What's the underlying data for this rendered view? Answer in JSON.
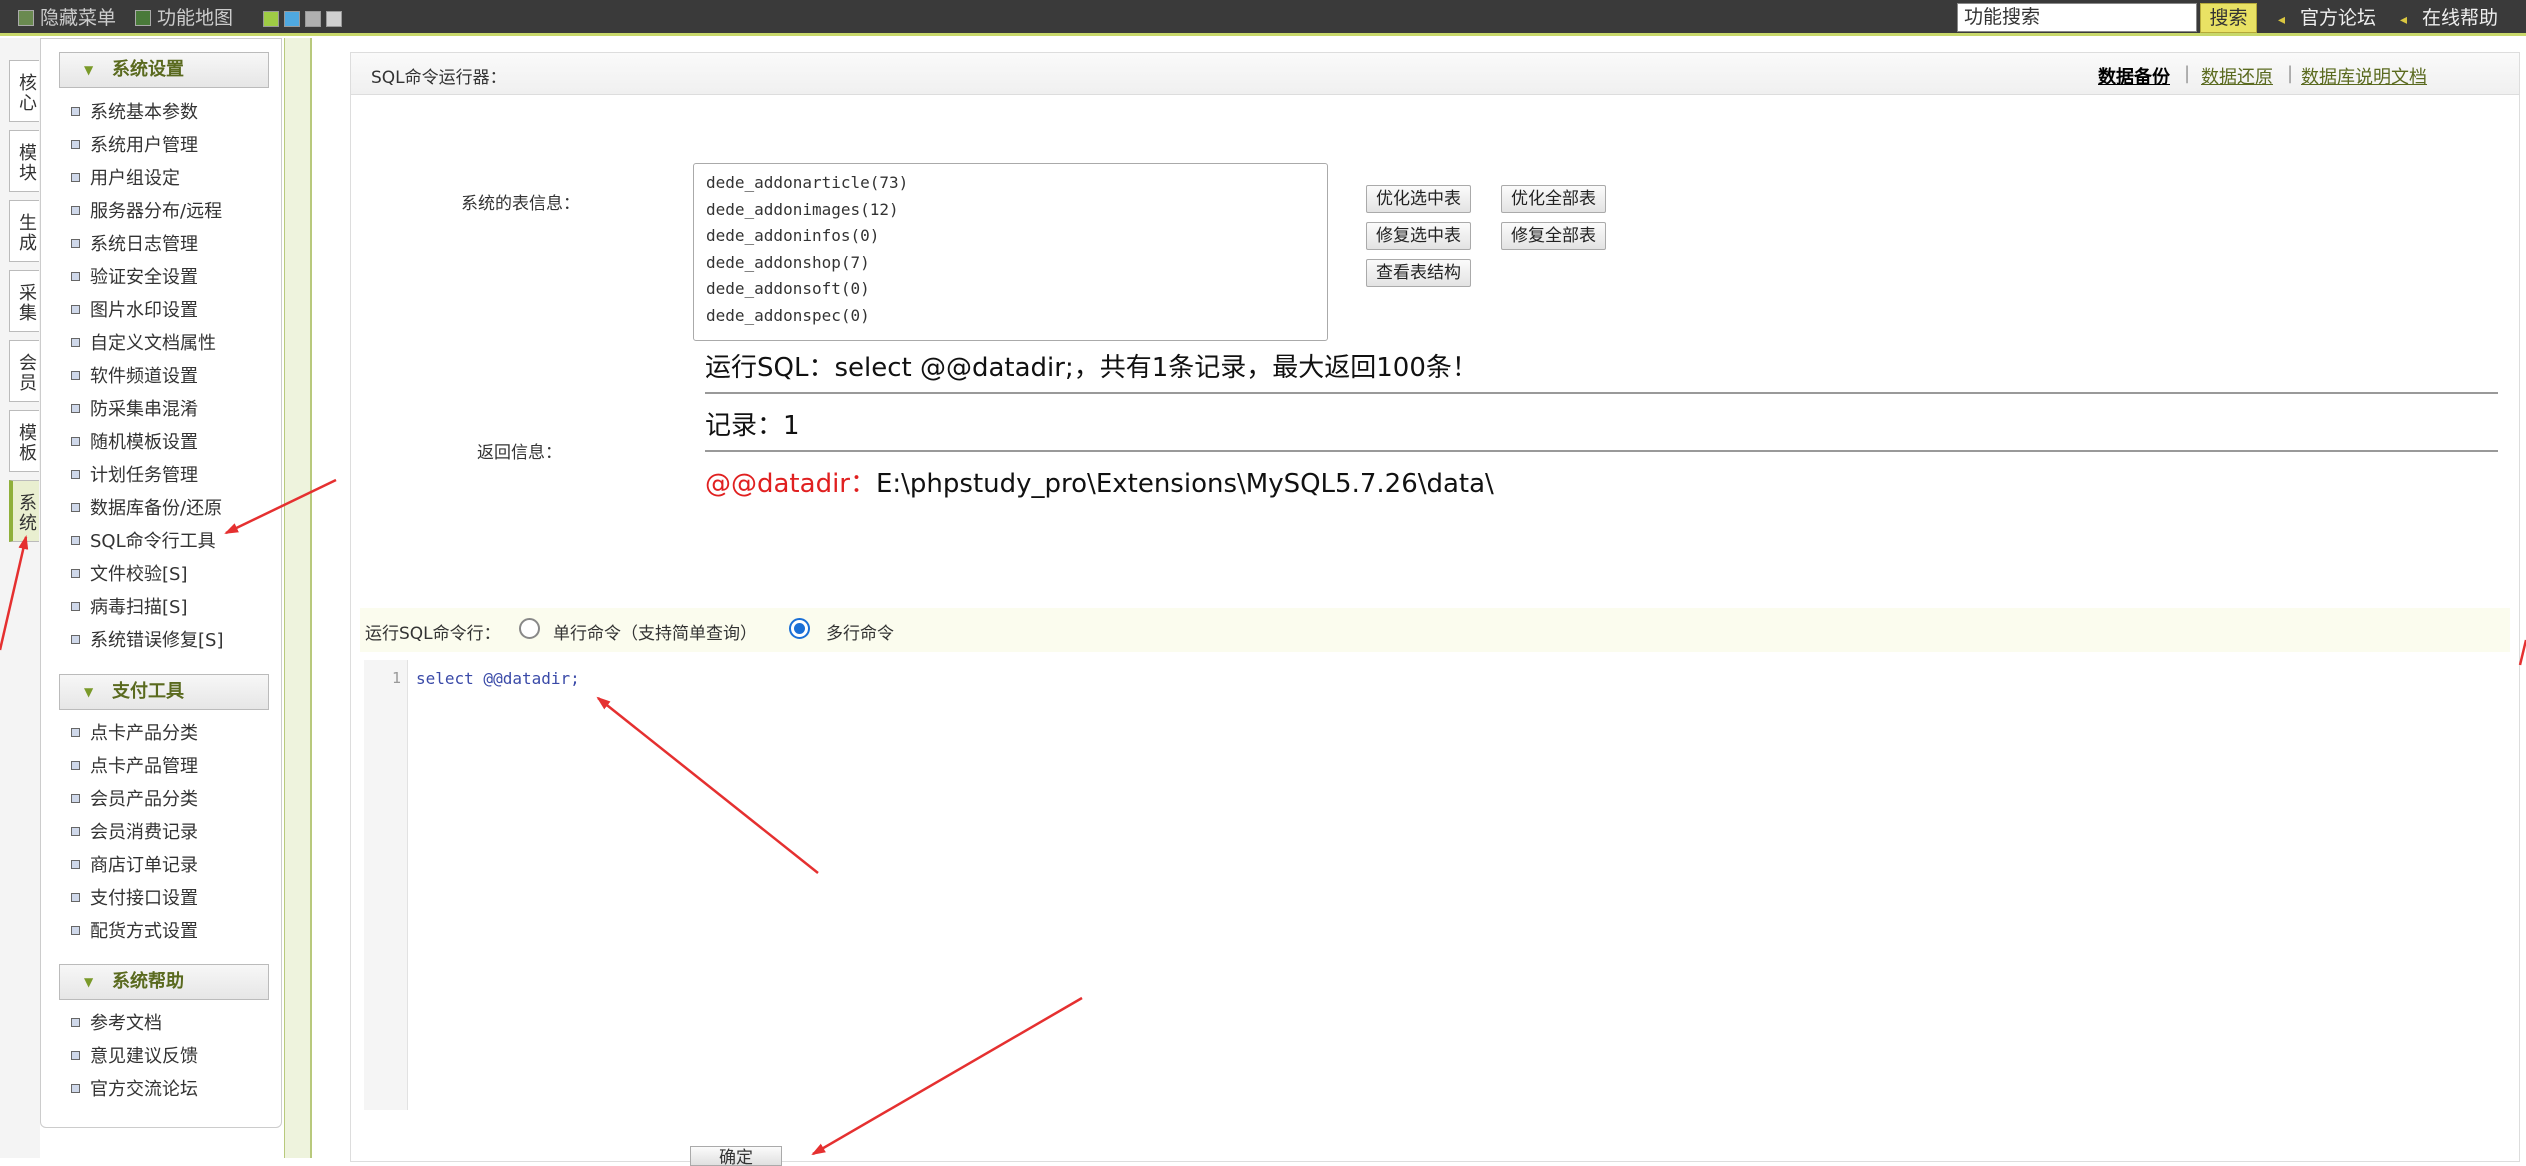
{
  "topbar": {
    "hide_menu": "隐藏菜单",
    "func_map": "功能地图",
    "swatch_colors": [
      "#9ecb45",
      "#4fa8e0",
      "#b0b0b0",
      "#d0d0d0"
    ],
    "search_placeholder": "功能搜索",
    "search_btn": "搜索",
    "forum": "官方论坛",
    "help": "在线帮助"
  },
  "vtabs": [
    "核心",
    "模块",
    "生成",
    "采集",
    "会员",
    "模板",
    "系统"
  ],
  "vtab_active": "系统",
  "sidebar": {
    "sections": [
      {
        "title": "系统设置",
        "items": [
          "系统基本参数",
          "系统用户管理",
          "用户组设定",
          "服务器分布/远程",
          "系统日志管理",
          "验证安全设置",
          "图片水印设置",
          "自定义文档属性",
          "软件频道设置",
          "防采集串混淆",
          "随机模板设置",
          "计划任务管理",
          "数据库备份/还原",
          "SQL命令行工具",
          "文件校验[S]",
          "病毒扫描[S]",
          "系统错误修复[S]"
        ]
      },
      {
        "title": "支付工具",
        "items": [
          "点卡产品分类",
          "点卡产品管理",
          "会员产品分类",
          "会员消费记录",
          "商店订单记录",
          "支付接口设置",
          "配货方式设置"
        ]
      },
      {
        "title": "系统帮助",
        "items": [
          "参考文档",
          "意见建议反馈",
          "官方交流论坛"
        ]
      }
    ]
  },
  "main": {
    "title": "SQL命令运行器：",
    "links": [
      "数据备份",
      "数据还原",
      "数据库说明文档"
    ],
    "table_info_label": "系统的表信息：",
    "tables": [
      "dede_addonarticle(73)",
      "dede_addonimages(12)",
      "dede_addoninfos(0)",
      "dede_addonshop(7)",
      "dede_addonsoft(0)",
      "dede_addonspec(0)"
    ],
    "buttons": {
      "optimize_selected": "优化选中表",
      "optimize_all": "优化全部表",
      "repair_selected": "修复选中表",
      "repair_all": "修复全部表",
      "view_structure": "查看表结构"
    },
    "return_label": "返回信息：",
    "result": {
      "run_sql": "运行SQL：select @@datadir;，共有1条记录，最大返回100条！",
      "records": "记录：1",
      "key": "@@datadir：",
      "value": "E:\\phpstudy_pro\\Extensions\\MySQL5.7.26\\data\\"
    },
    "run_label": "运行SQL命令行：",
    "radio_single": "单行命令（支持简单查询）",
    "radio_multi": "多行命令",
    "selected_mode": "多行命令",
    "editor": {
      "line_number": "1",
      "code": "select @@datadir;"
    },
    "submit": "确定"
  },
  "colors": {
    "accent_olive": "#5a6a1f",
    "radio_blue": "#1a6fd6",
    "key_red": "#e02020",
    "arrow_red": "#e53030"
  }
}
